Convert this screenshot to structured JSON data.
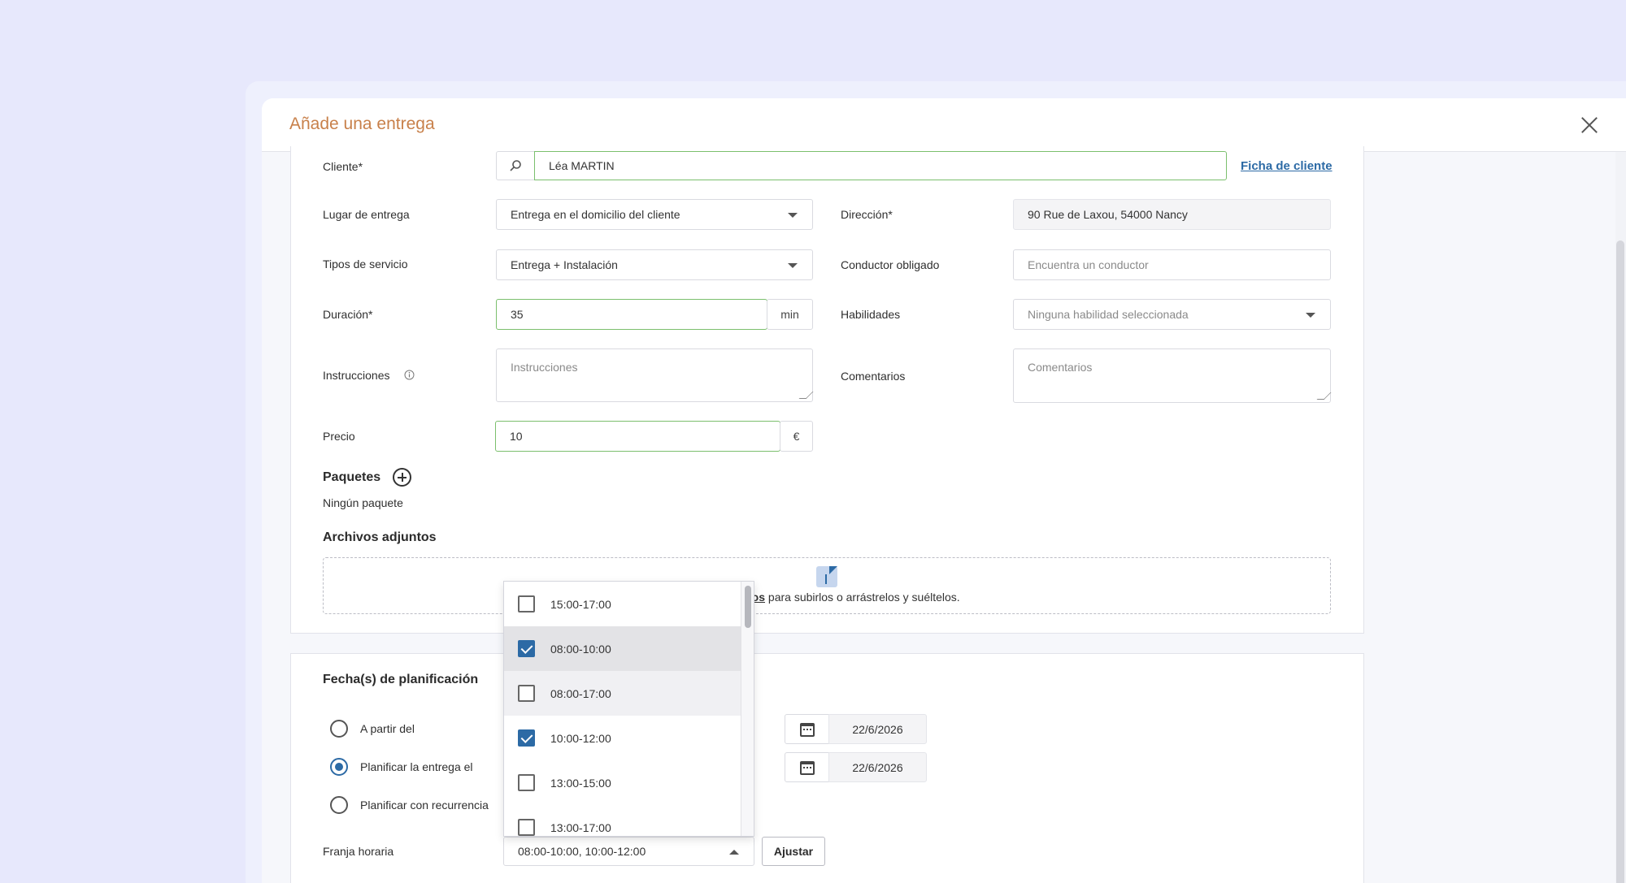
{
  "modal": {
    "title": "Añade una entrega"
  },
  "form": {
    "cliente": {
      "label": "Cliente*",
      "value": "Léa MARTIN",
      "link": "Ficha de cliente"
    },
    "lugar": {
      "label": "Lugar de entrega",
      "value": "Entrega en el domicilio del cliente"
    },
    "direccion": {
      "label": "Dirección*",
      "value": "90 Rue de Laxou, 54000 Nancy"
    },
    "tipos": {
      "label": "Tipos de servicio",
      "value": "Entrega + Instalación"
    },
    "conductor": {
      "label": "Conductor obligado",
      "placeholder": "Encuentra un conductor"
    },
    "duracion": {
      "label": "Duración*",
      "value": "35",
      "unit": "min"
    },
    "habilidades": {
      "label": "Habilidades",
      "placeholder": "Ninguna habilidad seleccionada"
    },
    "instrucciones": {
      "label": "Instrucciones",
      "placeholder": "Instrucciones"
    },
    "comentarios": {
      "label": "Comentarios",
      "placeholder": "Comentarios"
    },
    "precio": {
      "label": "Precio",
      "value": "10",
      "unit": "€"
    },
    "paquetes": {
      "title": "Paquetes",
      "empty": "Ningún paquete"
    },
    "adjuntos": {
      "title": "Archivos adjuntos",
      "link_fragment": "ivos",
      "text": " para subirlos o arrástrelos y suéltelos."
    }
  },
  "planning": {
    "title": "Fecha(s) de planificación",
    "options": [
      {
        "label": "A partir del",
        "selected": false,
        "date": "22/6/2026"
      },
      {
        "label": "Planificar la entrega el",
        "selected": true,
        "date": "22/6/2026"
      },
      {
        "label": "Planificar con recurrencia",
        "selected": false
      }
    ],
    "franja": {
      "label": "Franja horaria",
      "value": "08:00-10:00, 10:00-12:00",
      "button": "Ajustar"
    }
  },
  "time_slots": [
    {
      "label": "15:00-17:00",
      "checked": false
    },
    {
      "label": "08:00-10:00",
      "checked": true
    },
    {
      "label": "08:00-17:00",
      "checked": false
    },
    {
      "label": "10:00-12:00",
      "checked": true
    },
    {
      "label": "13:00-15:00",
      "checked": false
    },
    {
      "label": "13:00-17:00",
      "checked": false
    }
  ],
  "colors": {
    "accent": "#2c6aa5",
    "title": "#c8804a",
    "valid": "#7bbf6d"
  }
}
